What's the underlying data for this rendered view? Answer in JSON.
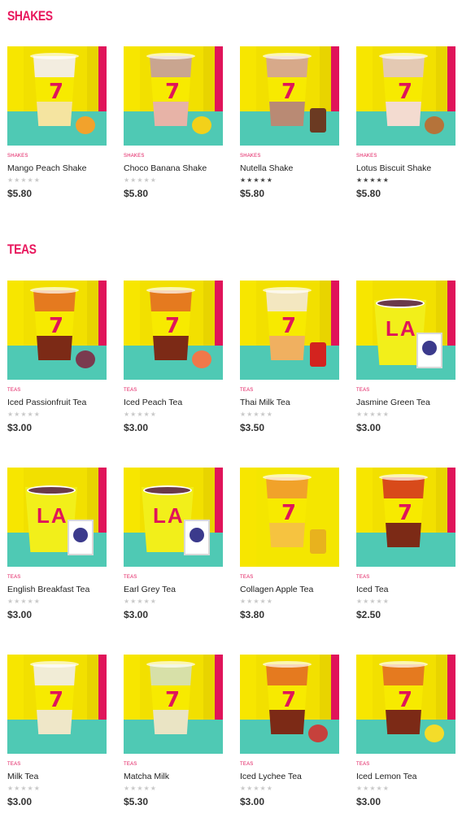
{
  "sections": [
    {
      "title": "SHAKES",
      "products": [
        {
          "category": "SHAKES",
          "name": "Mango Peach Shake",
          "price": "$5.80",
          "rating": 0,
          "top": "#f3ede0",
          "mid": "#f7ea00",
          "bot": "#f5e4a0",
          "accessory": "mango-peach-icon",
          "accColor": "#f2a22c"
        },
        {
          "category": "SHAKES",
          "name": "Choco Banana Shake",
          "price": "$5.80",
          "rating": 0,
          "top": "#c9a590",
          "mid": "#f7ea00",
          "bot": "#e7b3a7",
          "accessory": "banana-chocolate-icon",
          "accColor": "#f3d11a"
        },
        {
          "category": "SHAKES",
          "name": "Nutella Shake",
          "price": "$5.80",
          "rating": 5,
          "top": "#d7a98a",
          "mid": "#f7ea00",
          "bot": "#b98a74",
          "accessory": "nutella-jar-icon",
          "accColor": "#6b3a22"
        },
        {
          "category": "SHAKES",
          "name": "Lotus Biscuit Shake",
          "price": "$5.80",
          "rating": 5,
          "top": "#e4c9b3",
          "mid": "#f7ea00",
          "bot": "#f3dbd0",
          "accessory": "biscuit-icon",
          "accColor": "#b5733a"
        }
      ]
    },
    {
      "title": "TEAS",
      "products": [
        {
          "category": "TEAS",
          "name": "Iced Passionfruit Tea",
          "price": "$3.00",
          "rating": 0,
          "style": "cup",
          "top": "#e57a1f",
          "mid": "#f7ea00",
          "bot": "#7c2a16",
          "accessory": "passionfruit-icon",
          "accColor": "#7a3a4f"
        },
        {
          "category": "TEAS",
          "name": "Iced Peach Tea",
          "price": "$3.00",
          "rating": 0,
          "style": "cup",
          "top": "#e57a1f",
          "mid": "#f7ea00",
          "bot": "#7c2a16",
          "accessory": "peach-icon",
          "accColor": "#f0784a"
        },
        {
          "category": "TEAS",
          "name": "Thai Milk Tea",
          "price": "$3.50",
          "rating": 0,
          "style": "cup",
          "top": "#f3e7c0",
          "mid": "#f7ea00",
          "bot": "#f0b060",
          "accessory": "tea-tin-icon",
          "accColor": "#d3231f"
        },
        {
          "category": "TEAS",
          "name": "Jasmine Green Tea",
          "price": "$3.00",
          "rating": 0,
          "style": "paper",
          "accessory": "tea-box-icon",
          "accColor": "#3b3a8c"
        },
        {
          "category": "TEAS",
          "name": "English Breakfast Tea",
          "price": "$3.00",
          "rating": 0,
          "style": "paper",
          "accessory": "tea-box-icon",
          "accColor": "#3b3a8c"
        },
        {
          "category": "TEAS",
          "name": "Earl Grey Tea",
          "price": "$3.00",
          "rating": 0,
          "style": "paper",
          "accessory": "tea-box-icon",
          "accColor": "#3b3a8c"
        },
        {
          "category": "TEAS",
          "name": "Collagen Apple Tea",
          "price": "$3.80",
          "rating": 0,
          "style": "cup",
          "top": "#f1a22a",
          "mid": "#f7ea00",
          "bot": "#f6c340",
          "accessory": "collagen-bottle-icon",
          "accColor": "#e8b21e"
        },
        {
          "category": "TEAS",
          "name": "Iced Tea",
          "price": "$2.50",
          "rating": 0,
          "style": "cup",
          "top": "#d84a1a",
          "mid": "#f7ea00",
          "bot": "#7c2a16",
          "accessory": "none",
          "accColor": ""
        },
        {
          "category": "TEAS",
          "name": "Milk Tea",
          "price": "$3.00",
          "rating": 0,
          "style": "cup",
          "top": "#f1ecd6",
          "mid": "#f7ea00",
          "bot": "#efe7c8",
          "accessory": "none",
          "accColor": ""
        },
        {
          "category": "TEAS",
          "name": "Matcha Milk",
          "price": "$5.30",
          "rating": 0,
          "style": "cup",
          "top": "#d7e0a8",
          "mid": "#f7ea00",
          "bot": "#eae4c4",
          "accessory": "none",
          "accColor": ""
        },
        {
          "category": "TEAS",
          "name": "Iced Lychee Tea",
          "price": "$3.00",
          "rating": 0,
          "style": "cup",
          "top": "#e57a1f",
          "mid": "#f7ea00",
          "bot": "#7c2a16",
          "accessory": "lychee-icon",
          "accColor": "#c6413c"
        },
        {
          "category": "TEAS",
          "name": "Iced Lemon Tea",
          "price": "$3.00",
          "rating": 0,
          "style": "cup",
          "top": "#e57a1f",
          "mid": "#f7ea00",
          "bot": "#7c2a16",
          "accessory": "lemon-icon",
          "accColor": "#f4dc2a"
        }
      ]
    }
  ],
  "colors": {
    "accent": "#e8175d",
    "teal": "#4fc9b4",
    "yellow": "#f7ea00",
    "magenta": "#e0145a"
  },
  "ratingMax": 5
}
